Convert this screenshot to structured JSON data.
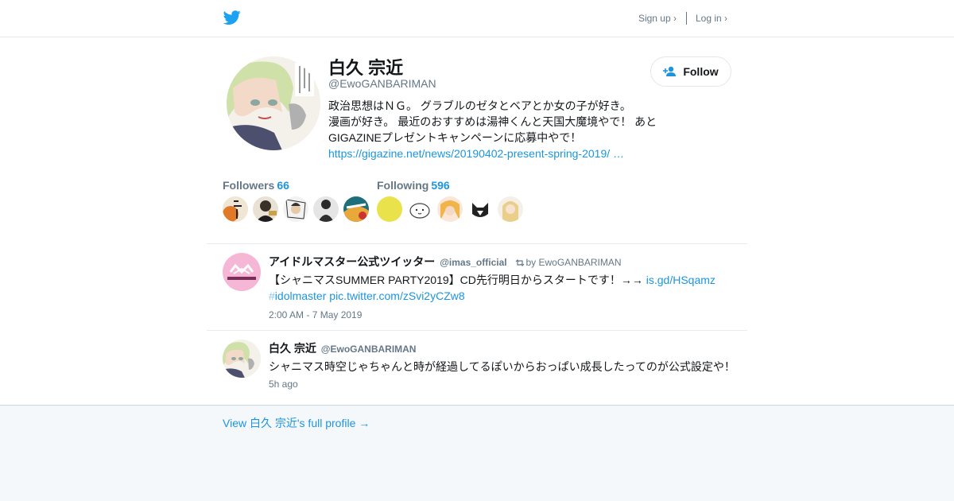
{
  "topbar": {
    "logo_icon": "twitter-bird-icon",
    "signup_label": "Sign up ›",
    "login_label": "Log in ›"
  },
  "profile": {
    "name": "白久 宗近",
    "handle": "@EwoGANBARIMAN",
    "bio_lines": [
      "政治思想はＮＧ。 グラブルのゼタとベアとか女の子が好き。",
      "漫画が好き。 最近のおすすめは湯神くんと天国大魔境やで！ あと",
      "GIGAZINEプレゼントキャンペーンに応募中やで！"
    ],
    "bio_link": "https://gigazine.net/news/20190402-present-spring-2019/ …",
    "follow_label": "Follow",
    "follow_icon": "add-user-icon"
  },
  "followers": {
    "label": "Followers",
    "count": "66"
  },
  "following": {
    "label": "Following",
    "count": "596"
  },
  "tweets": [
    {
      "name": "アイドルマスター公式ツイッター",
      "handle": "@imas_official",
      "retweet_text": "by EwoGANBARIMAN",
      "text_before": "【シャニマスSUMMER PARTY2019】CD先行明日からスタートです！→→",
      "link1": "is.gd/HSqamz",
      "hash_symbol": "#",
      "hashtag": "idolmaster",
      "pic_link": "pic.twitter.com/zSvi2yCZw8",
      "time": "2:00 AM - 7 May 2019"
    },
    {
      "name": "白久 宗近",
      "handle": "@EwoGANBARIMAN",
      "text": "シャニマス時空じゃちゃんと時が経過してるぽいからおっぱい成長したってのが公式設定や！",
      "time": "5h ago"
    }
  ],
  "footer": {
    "full_profile_link": "View 白久 宗近's full profile →"
  },
  "colors": {
    "accent": "#1b95e0",
    "muted": "#657786",
    "text": "#14171a",
    "bg": "#f5f8fa"
  }
}
